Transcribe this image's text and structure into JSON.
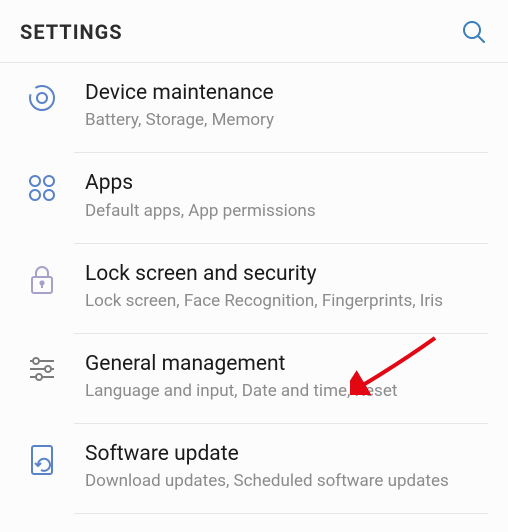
{
  "header": {
    "title": "SETTINGS"
  },
  "items": [
    {
      "title": "Device maintenance",
      "sub": "Battery, Storage, Memory"
    },
    {
      "title": "Apps",
      "sub": "Default apps, App permissions"
    },
    {
      "title": "Lock screen and security",
      "sub": "Lock screen, Face Recognition, Fingerprints, Iris"
    },
    {
      "title": "General management",
      "sub": "Language and input, Date and time, Reset"
    },
    {
      "title": "Software update",
      "sub": "Download updates, Scheduled software updates"
    }
  ]
}
